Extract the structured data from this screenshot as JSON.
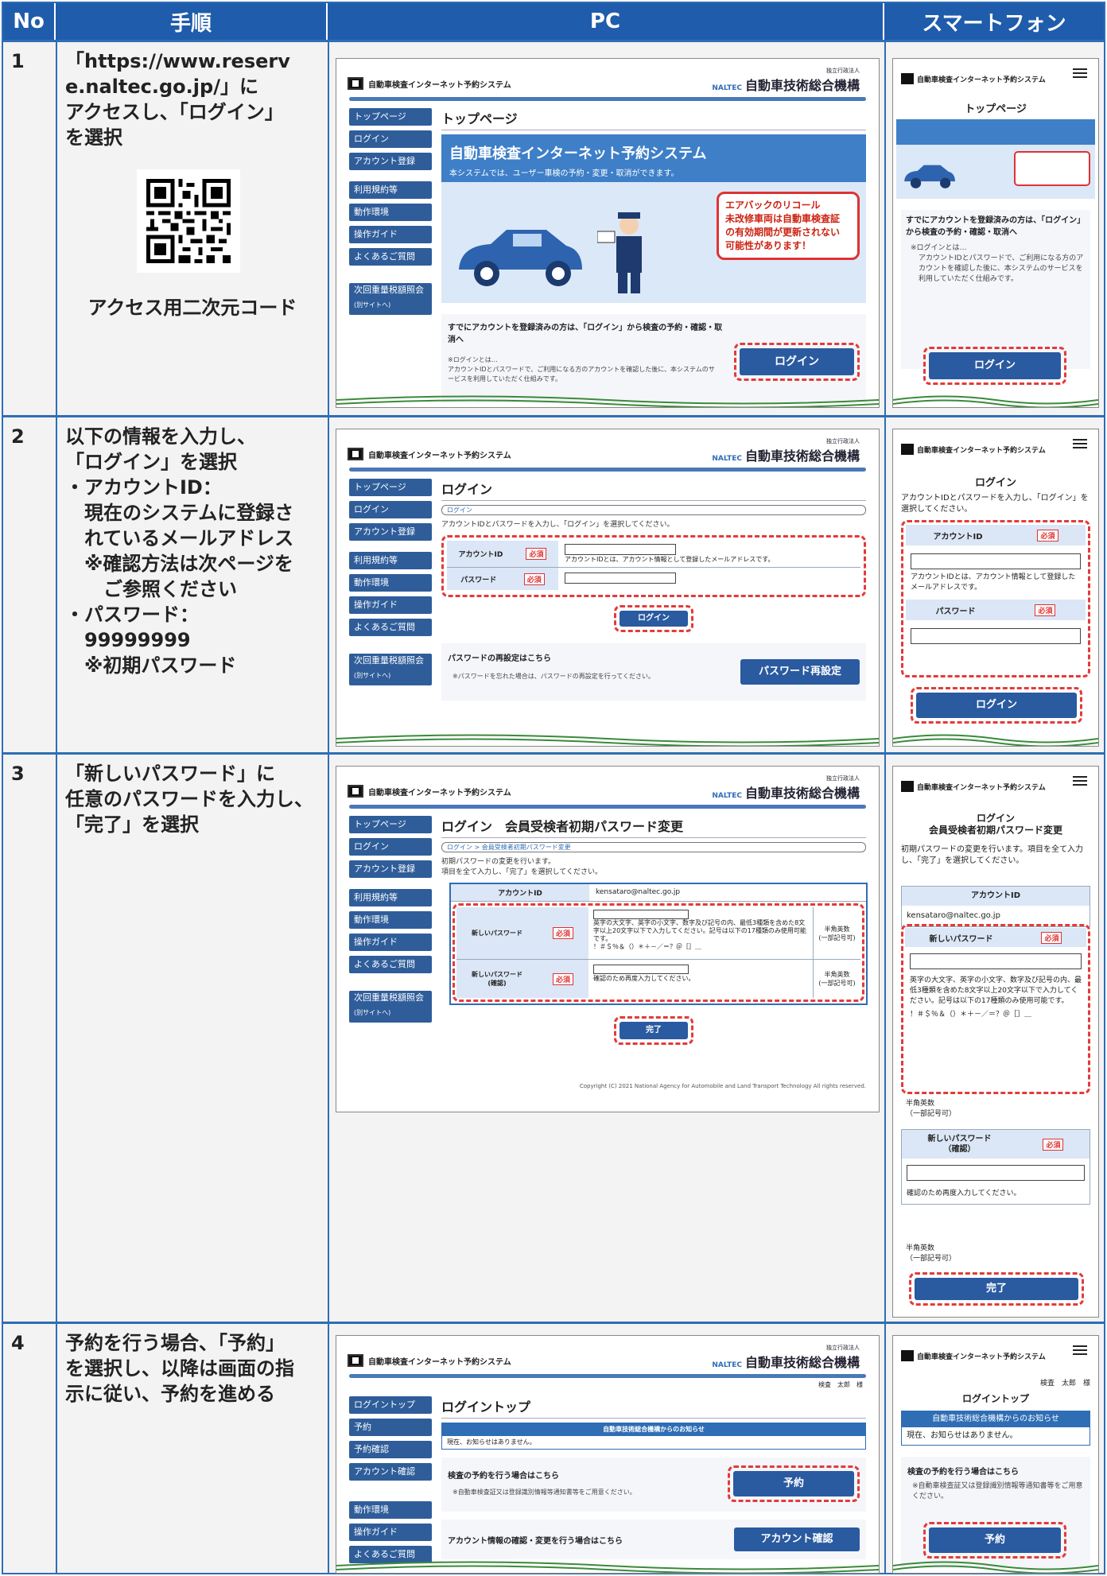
{
  "header": {
    "no": "No",
    "step": "手順",
    "pc": "PC",
    "sp": "スマートフォン"
  },
  "system_title": "自動車検査インターネット予約システム",
  "org": {
    "small": "独立行政法人",
    "name": "自動車技術総合機構",
    "abbr": "NALTEC",
    "en": "National Agency for Automobile and Land Transport Technology"
  },
  "rows": [
    {
      "no": "1",
      "step_lines": [
        "「https://www.reserv",
        "e.naltec.go.jp/」に",
        "アクセスし、「ログイン」",
        "を選択"
      ],
      "qr_caption": "アクセス用二次元コード",
      "pc": {
        "menu": [
          "トップページ",
          "ログイン",
          "アカウント登録",
          "利用規約等",
          "動作環境",
          "操作ガイド",
          "よくあるご質問",
          "次回重量税額照会",
          "(別サイトへ)"
        ],
        "title": "トップページ",
        "hero_title": "自動車検査インターネット予約システム",
        "hero_sub": "本システムでは、ユーザー車検の予約・変更・取消ができます。",
        "alert": [
          "エアバックのリコール",
          "未改修車両は自動車検査証",
          "の有効期間が更新されない",
          "可能性があります！"
        ],
        "login_heading": "すでにアカウントを登録済みの方は、「ログイン」から検査の予約・確認・取消へ",
        "login_note_head": "※ログインとは…",
        "login_note": "アカウントIDとパスワードで、ご利用になる方のアカウントを確認した後に、本システムのサービスを利用していただく仕組みです。",
        "login_btn": "ログイン"
      },
      "sp": {
        "title": "トップページ",
        "heading": "すでにアカウントを登録済みの方は、「ログイン」から検査の予約・確認・取消へ",
        "note_head": "※ログインとは…",
        "note": "アカウントIDとパスワードで、ご利用になる方のアカウントを確認した後に、本システムのサービスを利用していただく仕組みです。",
        "btn": "ログイン"
      }
    },
    {
      "no": "2",
      "step_lines": [
        "以下の情報を入力し、",
        "「ログイン」を選択",
        "",
        "・アカウントID：",
        "　現在のシステムに登録さ",
        "　れているメールアドレス",
        "　※確認方法は次ページを",
        "　　ご参照ください",
        "",
        "・パスワード：",
        "　99999999",
        "　※初期パスワード"
      ],
      "pc": {
        "menu": [
          "トップページ",
          "ログイン",
          "アカウント登録",
          "利用規約等",
          "動作環境",
          "操作ガイド",
          "よくあるご質問",
          "次回重量税額照会",
          "(別サイトへ)"
        ],
        "title": "ログイン",
        "crumb": "ログイン",
        "instr": "アカウントIDとパスワードを入力し、「ログイン」を選択してください。",
        "id_label": "アカウントID",
        "required": "必須",
        "id_hint": "アカウントIDとは、アカウント情報として登録したメールアドレスです。",
        "pw_label": "パスワード",
        "login_btn": "ログイン",
        "reset_heading": "パスワードの再設定はこちら",
        "reset_note": "※パスワードを忘れた場合は、パスワードの再設定を行ってください。",
        "reset_btn": "パスワード再設定"
      },
      "sp": {
        "title": "ログイン",
        "instr": "アカウントIDとパスワードを入力し、「ログイン」を選択してください。",
        "id_label": "アカウントID",
        "required": "必須",
        "id_hint": "アカウントIDとは、アカウント情報として登録したメールアドレスです。",
        "pw_label": "パスワード",
        "btn": "ログイン"
      }
    },
    {
      "no": "3",
      "step_lines": [
        "「新しいパスワード」に",
        "任意のパスワードを入力し、",
        "「完了」を選択"
      ],
      "pc": {
        "menu": [
          "トップページ",
          "ログイン",
          "アカウント登録",
          "利用規約等",
          "動作環境",
          "操作ガイド",
          "よくあるご質問",
          "次回重量税額照会",
          "(別サイトへ)"
        ],
        "title": "ログイン　会員受検者初期パスワード変更",
        "crumb": "ログイン > 会員受検者初期パスワード変更",
        "instr1": "初期パスワードの変更を行います。",
        "instr2": "項目を全て入力し、「完了」を選択してください。",
        "id_label": "アカウントID",
        "id_value": "kensataro@naltec.go.jp",
        "new_label": "新しいパスワード",
        "required": "必須",
        "new_hint": "英字の大文字、英字の小文字、数字及び記号の内、最低3種類を含めた8文字以上20文字以下で入力してください。記号は以下の17種類のみ使用可能です。",
        "symbols": "！＃＄％＆（）＊＋－／＝？＠［］＿",
        "half": "半角英数\n(一部記号可)",
        "confirm_label": "新しいパスワード\n(確認)",
        "confirm_hint": "確認のため再度入力してください。",
        "done_btn": "完了",
        "copyright": "Copyright (C) 2021 National Agency for Automobile and Land Transport Technology All rights reserved."
      },
      "sp": {
        "title1": "ログイン",
        "title2": "会員受検者初期パスワード変更",
        "instr": "初期パスワードの変更を行います。項目を全て入力し、「完了」を選択してください。",
        "id_label": "アカウントID",
        "id_value": "kensataro@naltec.go.jp",
        "new_label": "新しいパスワード",
        "required": "必須",
        "hint": "英字の大文字、英字の小文字、数字及び記号の内、最低3種類を含めた8文字以上20文字以下で入力してください。記号は以下の17種類のみ使用可能です。",
        "symbols": "！＃＄％＆（）＊＋－／＝？＠［］＿",
        "half1": "半角英数",
        "half2": "（一部記号可）",
        "confirm1": "新しいパスワード",
        "confirm2": "（確認）",
        "confirm_hint": "確認のため再度入力してください。",
        "btn": "完了"
      }
    },
    {
      "no": "4",
      "step_lines": [
        "予約を行う場合、「予約」",
        "を選択し、以降は画面の指",
        "示に従い、予約を進める"
      ],
      "pc": {
        "user": "検査　太郎　様",
        "menu": [
          "ログイントップ",
          "予約",
          "予約確認",
          "アカウント確認",
          "動作環境",
          "操作ガイド",
          "よくあるご質問"
        ],
        "title": "ログイントップ",
        "notice_head": "自動車技術総合機構からのお知らせ",
        "notice_body": "現在、お知らせはありません。",
        "reserve_heading": "検査の予約を行う場合はこちら",
        "reserve_note": "※自動車検査証又は登録識別情報等通知書等をご用意ください。",
        "reserve_btn": "予約",
        "account_heading": "アカウント情報の確認・変更を行う場合はこちら",
        "account_btn": "アカウント確認"
      },
      "sp": {
        "user": "検査　太郎　様",
        "title": "ログイントップ",
        "notice_head": "自動車技術総合機構からのお知らせ",
        "notice_body": "現在、お知らせはありません。",
        "reserve_heading": "検査の予約を行う場合はこちら",
        "reserve_note": "※自動車検査証又は登録識別情報等通知書等をご用意ください。",
        "btn": "予約"
      }
    }
  ]
}
